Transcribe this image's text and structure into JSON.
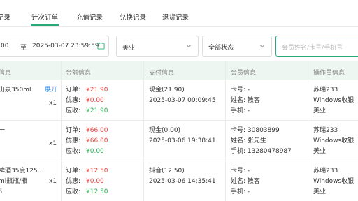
{
  "tabs": [
    {
      "label": "记录"
    },
    {
      "label": "计次订单"
    },
    {
      "label": "充值记录"
    },
    {
      "label": "兑换记录"
    },
    {
      "label": "退货记录"
    }
  ],
  "filters": {
    "date_start": "00",
    "date_sep": "至",
    "date_end": "2025-03-07 23:59:59",
    "store": "美业",
    "status": "全部状态",
    "search_placeholder": "会员姓名/卡号/手机号"
  },
  "columns": [
    "信息",
    "金额信息",
    "支付信息",
    "会员信息",
    "操作员信息"
  ],
  "rows": [
    {
      "product": "山泉350ml",
      "expand": "展开",
      "qty": "x1",
      "extra": "",
      "order_label": "订单:",
      "order_val": "¥21.90",
      "discount_label": "优惠:",
      "discount_val": "¥0.00",
      "receive_label": "应收:",
      "receive_val": "¥21.90",
      "pay_method": "现金(21.90)",
      "pay_time": "2025-03-07 00:09:45",
      "card": "卡号: -",
      "name": "姓名: 散客",
      "phone": "手机: -",
      "op_name": "苏瑞233",
      "op_terminal": "Windows收银",
      "op_store": "美业"
    },
    {
      "product": "一",
      "expand": "",
      "qty": "x1",
      "extra": "",
      "order_label": "订单:",
      "order_val": "¥66.00",
      "discount_label": "优惠:",
      "discount_val": "¥66.00",
      "receive_label": "应收:",
      "receive_val": "¥0.00",
      "pay_method": "现金(0.00)",
      "pay_time": "2025-03-06 19:38:41",
      "card": "卡号: 30803899",
      "name": "姓名: 张先生",
      "phone": "手机: 13280478987",
      "op_name": "苏瑞233",
      "op_terminal": "Windows收银",
      "op_store": "美业"
    },
    {
      "product": "啤酒35度125...",
      "expand": "",
      "qty": "x1",
      "extra": "ml瓶瓶/瓶",
      "extra2": "5",
      "order_label": "订单:",
      "order_val": "¥12.50",
      "discount_label": "优惠:",
      "discount_val": "¥0.00",
      "receive_label": "应收:",
      "receive_val": "¥12.50",
      "pay_method": "抖音(12.50)",
      "pay_time": "2025-03-06 14:35:41",
      "card": "卡号: -",
      "name": "姓名: 散客",
      "phone": "手机: -",
      "op_name": "苏瑞233",
      "op_terminal": "Windows收银",
      "op_store": "美业"
    }
  ],
  "colors": {
    "accent": "#2aa876",
    "red": "#ee3e3e",
    "green": "#2fae57",
    "link": "#2e8ef4"
  }
}
